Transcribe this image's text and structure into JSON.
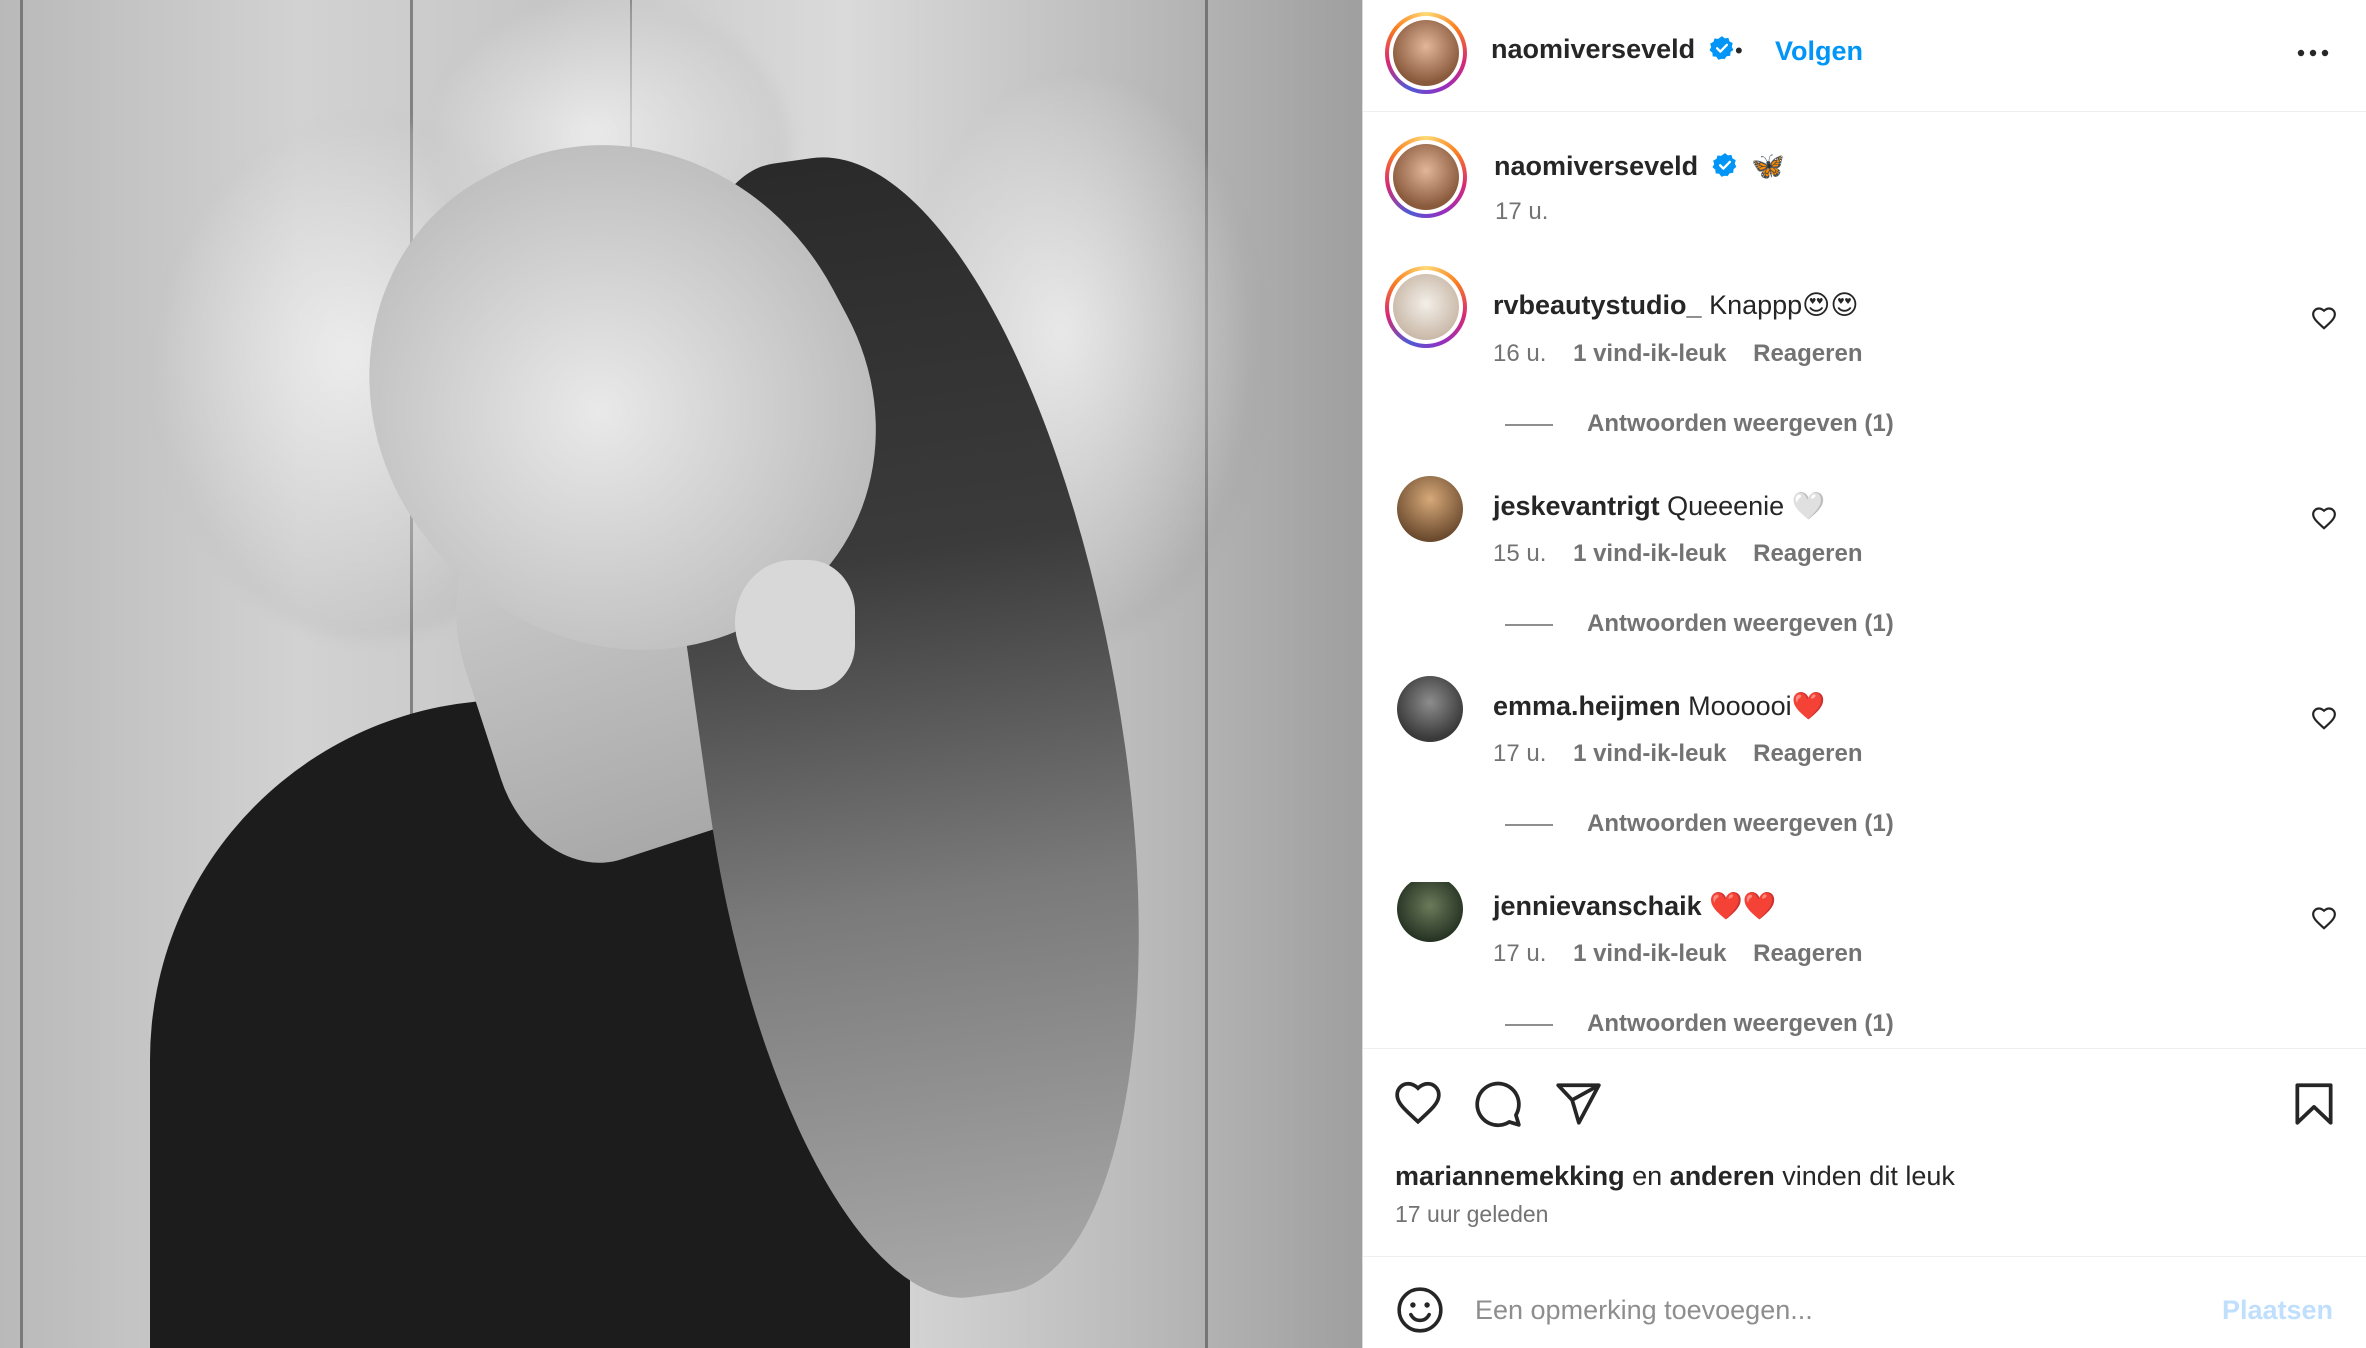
{
  "post": {
    "author": "naomiverseveld",
    "verified": true,
    "follow_label": "Volgen",
    "separator": "•",
    "more_icon": "more-horizontal-icon"
  },
  "caption": {
    "username": "naomiverseveld",
    "text": "🦋",
    "time": "17 u."
  },
  "comments": [
    {
      "username": "rvbeautystudio_",
      "text": "Knappp😍😍",
      "time": "16 u.",
      "likes": "1 vind-ik-leuk",
      "reply_label": "Reageren",
      "view_replies": "Antwoorden weergeven (1)"
    },
    {
      "username": "jeskevantrigt",
      "text": "Queeenie 🤍",
      "time": "15 u.",
      "likes": "1 vind-ik-leuk",
      "reply_label": "Reageren",
      "view_replies": "Antwoorden weergeven (1)"
    },
    {
      "username": "emma.heijmen",
      "text": "Moooooi❤️",
      "time": "17 u.",
      "likes": "1 vind-ik-leuk",
      "reply_label": "Reageren",
      "view_replies": "Antwoorden weergeven (1)"
    },
    {
      "username": "jennievanschaik",
      "text": "❤️❤️",
      "time": "17 u.",
      "likes": "1 vind-ik-leuk",
      "reply_label": "Reageren",
      "view_replies": "Antwoorden weergeven (1)"
    }
  ],
  "likes_line": {
    "liker": "mariannemekking",
    "connector": "en",
    "others": "anderen",
    "suffix": "vinden dit leuk"
  },
  "posted_time": "17 uur geleden",
  "add_comment": {
    "placeholder": "Een opmerking toevoegen...",
    "post_label": "Plaatsen"
  },
  "colors": {
    "accent": "#0095f6",
    "post_disabled": "#c0dffd",
    "secondary_text": "#737373",
    "primary_text": "#262626"
  }
}
